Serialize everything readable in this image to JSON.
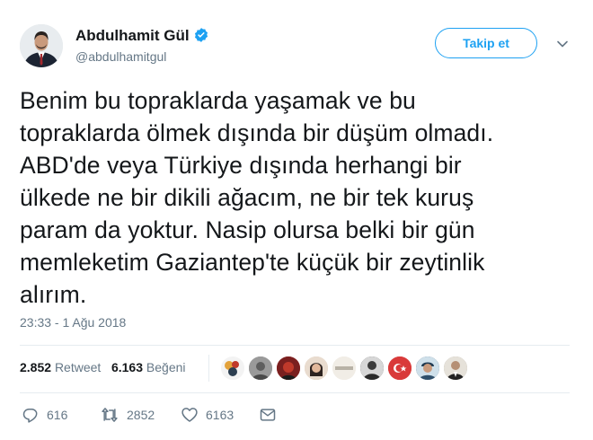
{
  "user": {
    "name": "Abdulhamit Gül",
    "handle": "@abdulhamitgul"
  },
  "follow_button": "Takip et",
  "tweet": {
    "lines": [
      "Benim bu topraklarda yaşamak ve bu",
      "topraklarda ölmek dışında bir düşüm olmadı.",
      "ABD'de veya Türkiye dışında herhangi bir",
      "ülkede ne bir dikili ağacım, ne bir tek kuruş",
      "param da yoktur. Nasip olursa belki bir gün",
      "memleketim Gaziantep'te küçük bir zeytinlik",
      "alırım."
    ],
    "timestamp": "23:33 - 1 Ağu 2018"
  },
  "stats": {
    "retweet_count": "2.852",
    "retweet_label": "Retweet",
    "like_count": "6.163",
    "like_label": "Beğeni"
  },
  "likers": [
    {
      "icon": "avatar-colorful",
      "color": "#e3a23b"
    },
    {
      "icon": "avatar-gray",
      "color": "#8c8c8c"
    },
    {
      "icon": "avatar-red",
      "color": "#b22a2a"
    },
    {
      "icon": "avatar-woman",
      "color": "#d9c3b0"
    },
    {
      "icon": "avatar-text-logo",
      "color": "#f1ede6",
      "text": "DERGİSİRAN"
    },
    {
      "icon": "avatar-dark",
      "color": "#3b3b3b"
    },
    {
      "icon": "avatar-flag",
      "color": "#d93a3a"
    },
    {
      "icon": "avatar-man-cap",
      "color": "#2f4f6a"
    },
    {
      "icon": "avatar-suit",
      "color": "#a79e8f"
    }
  ],
  "actions": {
    "reply_count": "616",
    "retweet_count": "2852",
    "like_count": "6163"
  },
  "colors": {
    "accent": "#1da1f2",
    "secondary_text": "#657786",
    "divider": "#e6ecf0",
    "verified": "#1da1f2"
  }
}
